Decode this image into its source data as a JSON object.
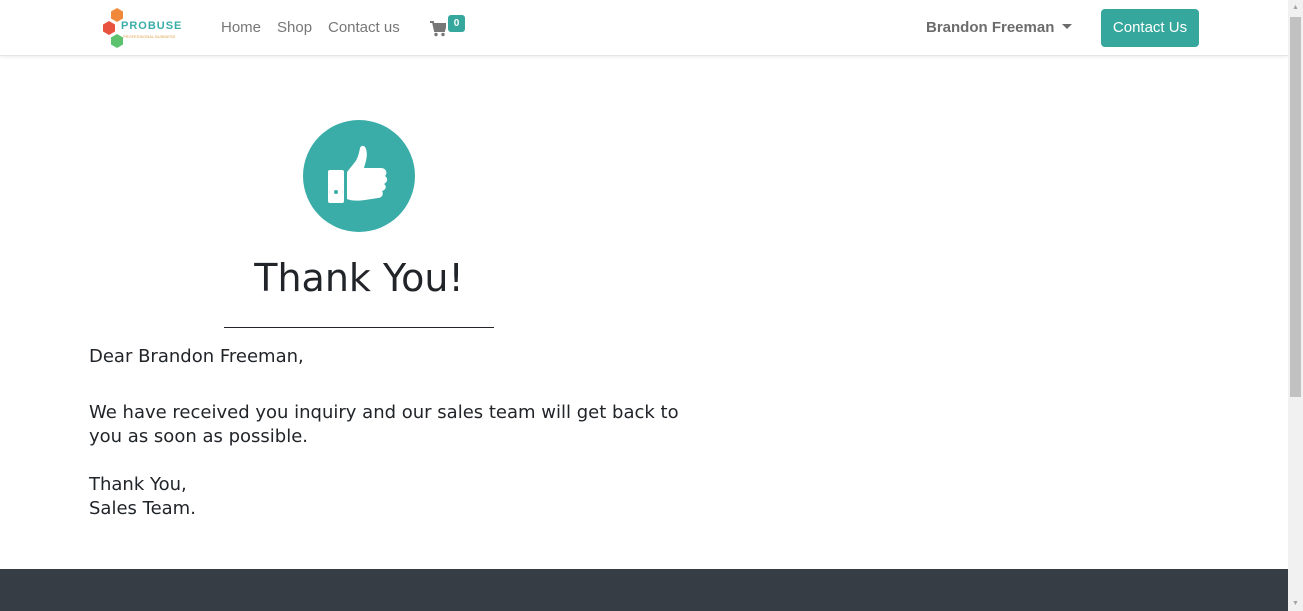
{
  "brand": {
    "name": "PROBUSE",
    "tagline": "PROFESSIONAL BUSINESS"
  },
  "nav": {
    "links": [
      {
        "label": "Home"
      },
      {
        "label": "Shop"
      },
      {
        "label": "Contact us"
      }
    ],
    "cart_count": "0",
    "user_name": "Brandon Freeman",
    "contact_button": "Contact Us"
  },
  "confirmation": {
    "icon": "thumbs-up-icon",
    "title": "Thank You!",
    "greeting": "Dear Brandon Freeman,",
    "message_line1": "We have received you inquiry and our sales team will get back to",
    "message_line2": "you as soon as possible.",
    "signoff": "Thank You,",
    "signature": "Sales Team."
  },
  "colors": {
    "accent": "#35a79c",
    "icon_circle": "#3aada8",
    "footer": "#373d44"
  }
}
